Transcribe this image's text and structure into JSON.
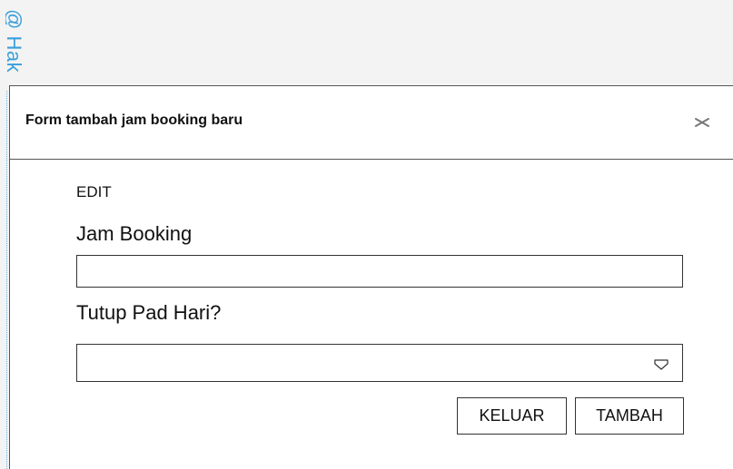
{
  "watermark": {
    "text": "@ Hak"
  },
  "modal": {
    "title": "Form tambah jam booking baru",
    "close_icon": "close-icon",
    "section_label": "EDIT",
    "fields": {
      "jam_booking": {
        "label": "Jam Booking",
        "value": "",
        "placeholder": ""
      },
      "tutup": {
        "label": "Tutup Pad Hari?",
        "selected": "",
        "chevron_icon": "chevron-down-icon"
      }
    },
    "buttons": {
      "keluar": "KELUAR",
      "tambah": "TAMBAH"
    }
  },
  "colors": {
    "background": "#f3f3f3",
    "watermark": "#3a9fdc",
    "border": "#555555"
  }
}
